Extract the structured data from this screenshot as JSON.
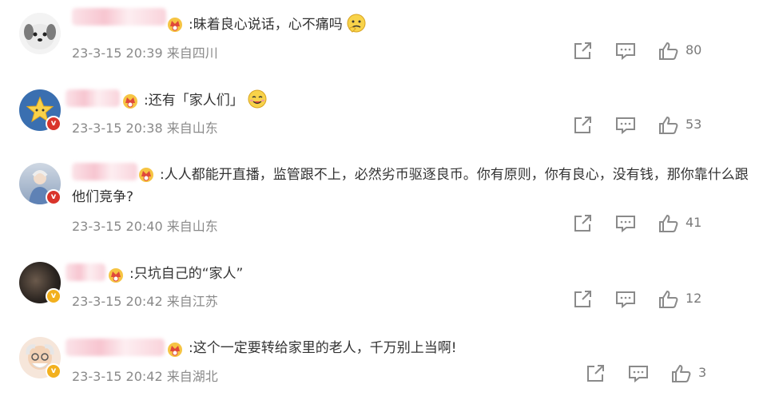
{
  "comments": [
    {
      "text": ":昧着良心说话，心不痛吗",
      "time": "23-3-15 20:39",
      "location": "来自四川",
      "likes": "80"
    },
    {
      "text": ":还有「家人们」",
      "time": "23-3-15 20:38",
      "location": "来自山东",
      "likes": "53"
    },
    {
      "text": ":人人都能开直播，监管跟不上，必然劣币驱逐良币。你有原则，你有良心，没有钱，那你靠什么跟他们竞争?",
      "time": "23-3-15 20:40",
      "location": "来自山东",
      "likes": "41"
    },
    {
      "text": ":只坑自己的“家人”",
      "time": "23-3-15 20:42",
      "location": "来自江苏",
      "likes": "12"
    },
    {
      "text": ":这个一定要转给家里的老人，千万别上当啊!",
      "time": "23-3-15 20:42",
      "location": "来自湖北",
      "likes": "3"
    }
  ],
  "icons": {
    "share": "share-icon",
    "comment": "comment-icon",
    "like": "thumbs-up-icon"
  },
  "colors": {
    "verified_red": "#d9342b",
    "verified_gold": "#f2b01e",
    "meta": "#8a8a8a"
  }
}
